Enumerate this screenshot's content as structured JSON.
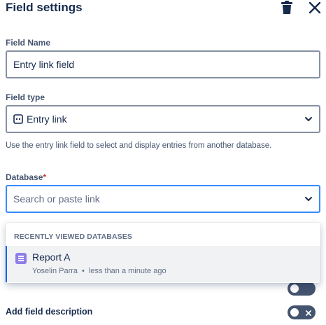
{
  "panel": {
    "title": "Field settings"
  },
  "field_name": {
    "label": "Field Name",
    "value": "Entry link field"
  },
  "field_type": {
    "label": "Field type",
    "value": "Entry link",
    "icon": "entry-link-icon",
    "helper": "Use the entry link field to select and display entries from another database."
  },
  "database": {
    "label": "Database",
    "required_marker": "*",
    "placeholder": "Search or paste link"
  },
  "dropdown": {
    "section_title": "RECENTLY VIEWED DATABASES",
    "items": [
      {
        "name": "Report A",
        "owner": "Yoselin Parra",
        "separator": "•",
        "time": "less than a minute ago",
        "icon": "database-icon",
        "icon_color": "#8f7ee7"
      }
    ]
  },
  "toggles": {
    "add_field_description": {
      "label": "Add field description",
      "state": "off"
    }
  },
  "colors": {
    "focus_border": "#388bff",
    "selected_bar": "#0c66e4",
    "toggle_off": "#44546f"
  }
}
